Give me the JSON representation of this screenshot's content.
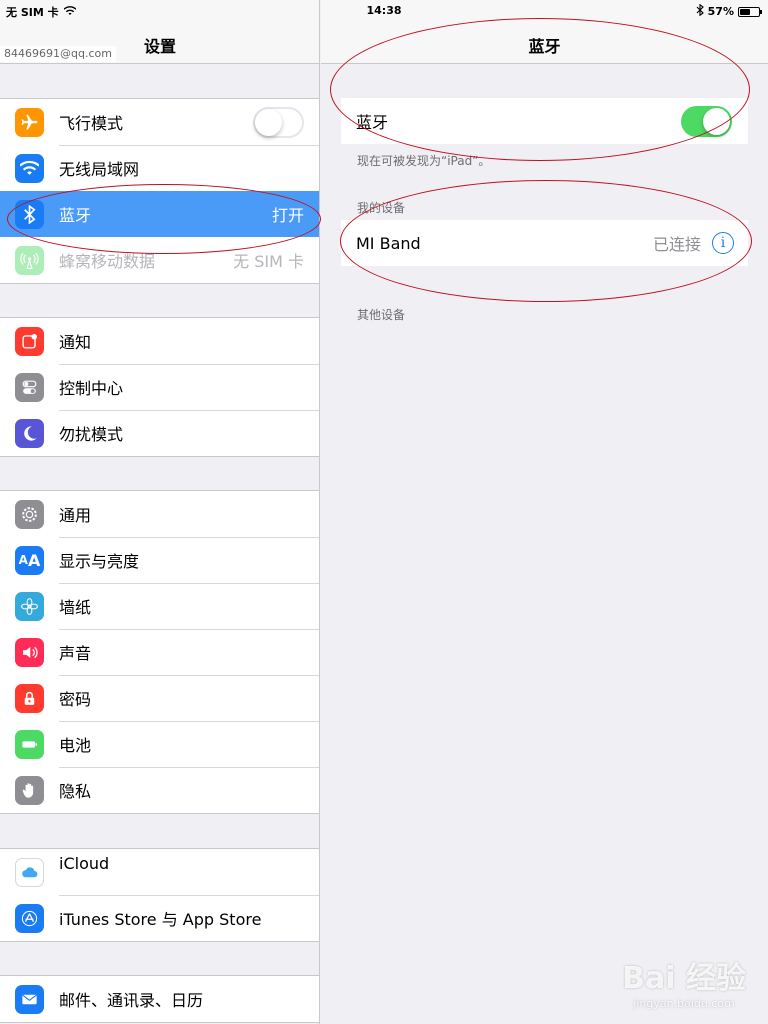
{
  "status_bar": {
    "carrier": "无 SIM 卡",
    "time": "14:38",
    "battery": "57%",
    "battery_level": 0.57
  },
  "left": {
    "title": "设置",
    "account": "84469691@qq.com",
    "groups": [
      [
        {
          "label": "飞行模式",
          "icon": "airplane-icon",
          "color": "#ff9500",
          "toggle": "off"
        },
        {
          "label": "无线局域网",
          "icon": "wifi-icon",
          "color": "#1a7cf4"
        },
        {
          "label": "蓝牙",
          "detail": "打开",
          "icon": "bluetooth-icon",
          "color": "#1a7cf4",
          "selected": true
        },
        {
          "label": "蜂窝移动数据",
          "detail": "无 SIM 卡",
          "icon": "antenna-icon",
          "color": "#4cd964",
          "dim": true
        }
      ],
      [
        {
          "label": "通知",
          "icon": "notifications-icon",
          "color": "#ff3b30"
        },
        {
          "label": "控制中心",
          "icon": "switches-icon",
          "color": "#8e8e93"
        },
        {
          "label": "勿扰模式",
          "icon": "moon-icon",
          "color": "#5856d6"
        }
      ],
      [
        {
          "label": "通用",
          "icon": "gear-icon",
          "color": "#8e8e93"
        },
        {
          "label": "显示与亮度",
          "icon": "text-size-icon",
          "color": "#1a7cf4"
        },
        {
          "label": "墙纸",
          "icon": "flower-icon",
          "color": "#34aadc"
        },
        {
          "label": "声音",
          "icon": "speaker-icon",
          "color": "#ff2d55"
        },
        {
          "label": "密码",
          "icon": "lock-icon",
          "color": "#ff3b30"
        },
        {
          "label": "电池",
          "icon": "battery-icon",
          "color": "#4cd964"
        },
        {
          "label": "隐私",
          "icon": "hand-icon",
          "color": "#8e8e93"
        }
      ],
      [
        {
          "label": "iCloud",
          "icon": "cloud-icon",
          "color": "#ffffff"
        },
        {
          "label": "iTunes Store 与 App Store",
          "icon": "app-store-icon",
          "color": "#1a7cf4"
        }
      ],
      [
        {
          "label": "邮件、通讯录、日历",
          "icon": "mail-icon",
          "color": "#1a7cf4"
        }
      ]
    ]
  },
  "right": {
    "title": "蓝牙",
    "bluetooth_label": "蓝牙",
    "bluetooth_on": true,
    "discoverable_note": "现在可被发现为“iPad”。",
    "my_devices_header": "我的设备",
    "device": {
      "name": "MI Band",
      "status": "已连接",
      "info": "i"
    },
    "other_devices_header": "其他设备"
  },
  "watermark": {
    "main": "Bai 经验",
    "sub": "jingyan.baidu.com"
  }
}
